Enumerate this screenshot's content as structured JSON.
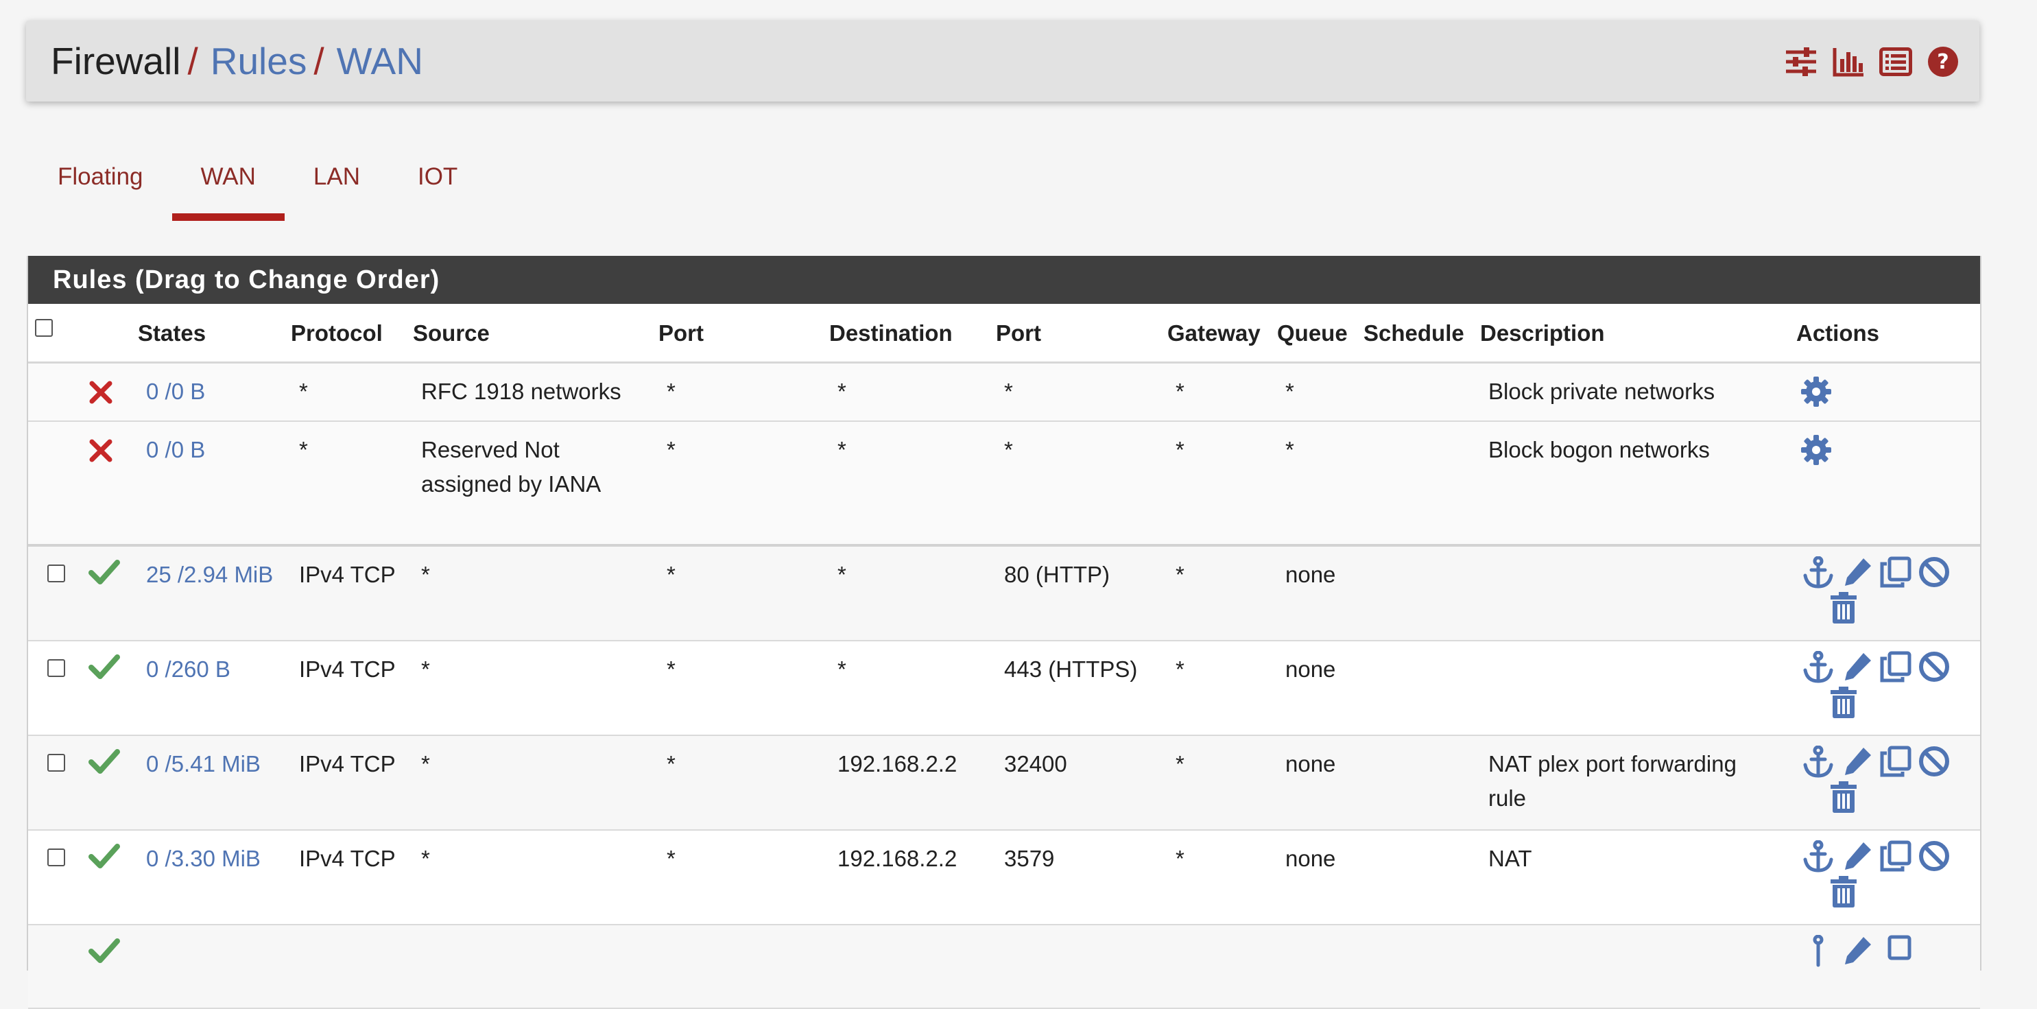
{
  "breadcrumb": {
    "root": "Firewall",
    "sep": "/",
    "level1": "Rules",
    "level2": "WAN"
  },
  "header_icons": [
    "sliders-icon",
    "chart-icon",
    "list-icon",
    "help-icon"
  ],
  "tabs": [
    {
      "label": "Floating",
      "active": false
    },
    {
      "label": "WAN",
      "active": true
    },
    {
      "label": "LAN",
      "active": false
    },
    {
      "label": "IOT",
      "active": false
    }
  ],
  "panel": {
    "title": "Rules (Drag to Change Order)"
  },
  "columns": {
    "states": "States",
    "protocol": "Protocol",
    "source": "Source",
    "port": "Port",
    "destination": "Destination",
    "dport": "Port",
    "gateway": "Gateway",
    "queue": "Queue",
    "schedule": "Schedule",
    "description": "Description",
    "actions": "Actions"
  },
  "rows": [
    {
      "status": "block",
      "selectable": false,
      "states": "0 /0 B",
      "protocol": "*",
      "source": "RFC 1918 networks",
      "port": "*",
      "destination": "*",
      "dport": "*",
      "gateway": "*",
      "queue": "*",
      "schedule": "",
      "description": "Block private networks",
      "actions": [
        "gear-icon"
      ]
    },
    {
      "status": "block",
      "selectable": false,
      "states": "0 /0 B",
      "protocol": "*",
      "source": "Reserved Not assigned by IANA",
      "port": "*",
      "destination": "*",
      "dport": "*",
      "gateway": "*",
      "queue": "*",
      "schedule": "",
      "description": "Block bogon networks",
      "actions": [
        "gear-icon"
      ]
    },
    {
      "status": "pass",
      "selectable": true,
      "states": "25 /2.94 MiB",
      "protocol": "IPv4 TCP",
      "source": "*",
      "port": "*",
      "destination": "*",
      "dport": "80 (HTTP)",
      "gateway": "*",
      "queue": "none",
      "schedule": "",
      "description": "",
      "actions": [
        "anchor-icon",
        "pencil-icon",
        "copy-icon",
        "ban-icon",
        "trash-icon"
      ]
    },
    {
      "status": "pass",
      "selectable": true,
      "states": "0 /260 B",
      "protocol": "IPv4 TCP",
      "source": "*",
      "port": "*",
      "destination": "*",
      "dport": "443 (HTTPS)",
      "gateway": "*",
      "queue": "none",
      "schedule": "",
      "description": "",
      "actions": [
        "anchor-icon",
        "pencil-icon",
        "copy-icon",
        "ban-icon",
        "trash-icon"
      ]
    },
    {
      "status": "pass",
      "selectable": true,
      "states": "0 /5.41 MiB",
      "protocol": "IPv4 TCP",
      "source": "*",
      "port": "*",
      "destination": "192.168.2.2",
      "dport": "32400",
      "gateway": "*",
      "queue": "none",
      "schedule": "",
      "description": "NAT plex port forwarding rule",
      "actions": [
        "anchor-icon",
        "pencil-icon",
        "copy-icon",
        "ban-icon",
        "trash-icon"
      ]
    },
    {
      "status": "pass",
      "selectable": true,
      "states": "0 /3.30 MiB",
      "protocol": "IPv4 TCP",
      "source": "*",
      "port": "*",
      "destination": "192.168.2.2",
      "dport": "3579",
      "gateway": "*",
      "queue": "none",
      "schedule": "",
      "description": "NAT",
      "actions": [
        "anchor-icon",
        "pencil-icon",
        "copy-icon",
        "ban-icon",
        "trash-icon"
      ]
    }
  ],
  "colors": {
    "breadcrumb_sep": "#9e2a27",
    "link": "#4f74b3",
    "tab_text": "#8b2b26",
    "tab_active_bar": "#b0201c",
    "panel_head": "#3f3f3f",
    "block_x": "#c62828",
    "pass_check": "#5aa15a"
  }
}
